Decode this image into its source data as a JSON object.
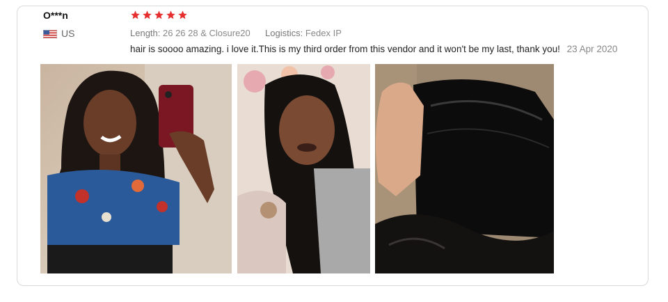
{
  "review": {
    "user": "O***n",
    "country": "US",
    "rating": 5,
    "star_color": "#e62e2e",
    "length_label": "Length:",
    "length_value": "26 26 28 & Closure20",
    "logistics_label": "Logistics:",
    "logistics_value": "Fedex IP",
    "text": "hair is soooo amazing. i love it.This is my third order from this vendor and it won't be my last, thank you!",
    "date": "23 Apr 2020"
  },
  "photos": [
    {
      "name": "review-photo-1"
    },
    {
      "name": "review-photo-2"
    },
    {
      "name": "review-photo-3"
    }
  ]
}
